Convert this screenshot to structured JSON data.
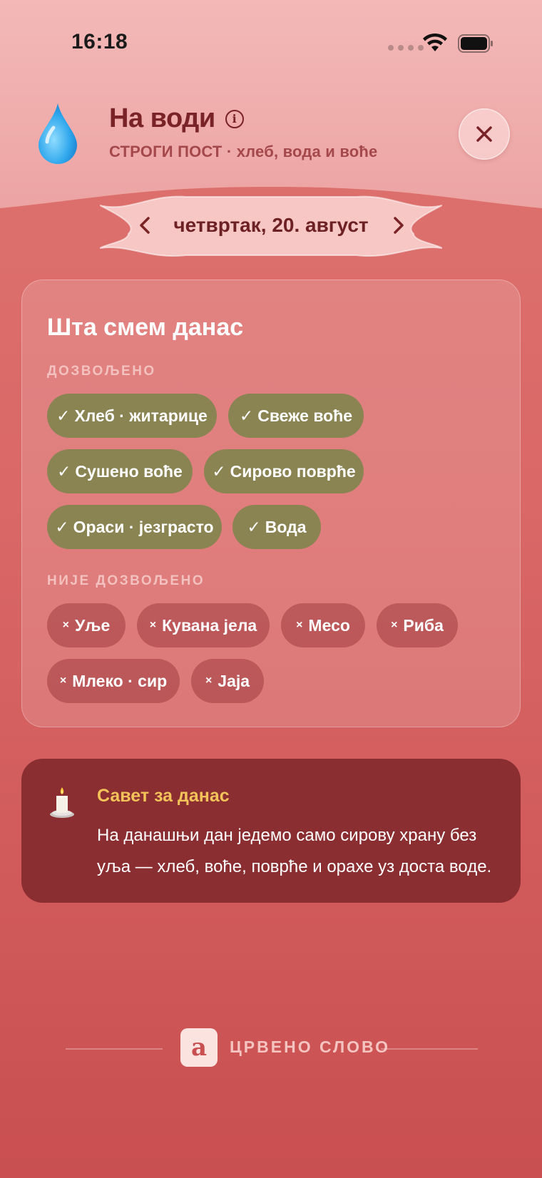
{
  "status_bar": {
    "time": "16:18"
  },
  "header": {
    "icon": "water-drop-icon",
    "title": "На води",
    "subtitle": "СТРОГИ ПОСТ · хлеб, вода и воће"
  },
  "date_nav": {
    "date": "четвртак, 20. август",
    "prev": "‹",
    "next": "›"
  },
  "today": {
    "title": "Шта смем данас",
    "allowed_label": "ДОЗВОЉЕНО",
    "allowed": [
      {
        "mark": "✓",
        "label": "Хлеб · житарице"
      },
      {
        "mark": "✓",
        "label": "Свеже воће"
      },
      {
        "mark": "✓",
        "label": "Сушено воће"
      },
      {
        "mark": "✓",
        "label": "Сирово поврће"
      },
      {
        "mark": "✓",
        "label": "Ораси · језграсто"
      },
      {
        "mark": "✓",
        "label": "Вода"
      }
    ],
    "forbidden_label": "НИЈЕ ДОЗВОЉЕНО",
    "forbidden": [
      {
        "mark": "×",
        "label": "Уље"
      },
      {
        "mark": "×",
        "label": "Кувана јела"
      },
      {
        "mark": "×",
        "label": "Месо"
      },
      {
        "mark": "×",
        "label": "Риба"
      },
      {
        "mark": "×",
        "label": "Млеко · сир"
      },
      {
        "mark": "×",
        "label": "Јаја"
      }
    ]
  },
  "tip": {
    "icon": "candle-icon",
    "title": "Савет за данас",
    "text": "На данашњи дан једемо само сирову храну без уља — хлеб, воће, поврће и орахе уз доста воде."
  },
  "footer": {
    "logo_letter": "а",
    "brand": "ЦРВЕНО СЛОВО"
  },
  "colors": {
    "accent": "#7a2326",
    "allowed_chip": "#8a8452",
    "tip_bg": "#8a2e31",
    "tip_title": "#f3c35a"
  }
}
